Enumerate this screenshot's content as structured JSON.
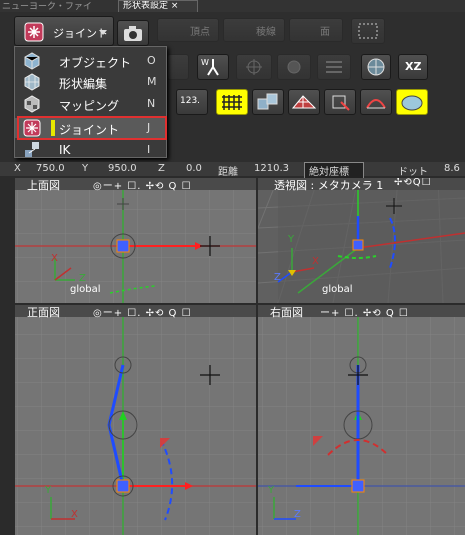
{
  "top_strip": {
    "left_text": "ニューヨーク・ファイ",
    "active_tab": "形状表設定 ×"
  },
  "mode_button": {
    "label": "ジョイント"
  },
  "view_tabs": [
    "頂点",
    "稜線",
    "面"
  ],
  "axis_button": "XZ",
  "numeric_button": "123.",
  "menu": {
    "items": [
      {
        "label": "オブジェクト",
        "key": "O",
        "icon": "cube-icon"
      },
      {
        "label": "形状編集",
        "key": "M",
        "icon": "mesh-cube-icon"
      },
      {
        "label": "マッピング",
        "key": "N",
        "icon": "checker-cube-icon"
      },
      {
        "label": "ジョイント",
        "key": "J",
        "icon": "joint-icon"
      },
      {
        "label": "IK",
        "key": "I",
        "icon": "ik-chain-icon"
      }
    ],
    "selected_index": 3
  },
  "coords": {
    "x_label": "X",
    "x_value": "750.0",
    "y_label": "Y",
    "y_value": "950.0",
    "z_label": "Z",
    "z_value": "0.0",
    "dist_label": "距離",
    "dist_value": "1210.3",
    "mode_select": "絶対座標",
    "dot_label": "ドット",
    "dot_value": "8.6"
  },
  "viewports": [
    {
      "title": "上面図",
      "tools": "◎ー+ ☐.    ✢⟲ Q ☐",
      "global_label": "global"
    },
    {
      "title": "透視図 : メタカメラ 1",
      "tools": "✢⟲Q☐",
      "global_label": "global"
    },
    {
      "title": "正面図",
      "tools": "◎ー+ ☐.    ✢⟲ Q ☐",
      "global_label": ""
    },
    {
      "title": "右面図",
      "tools": "ー+ ☐.    ✢⟲ Q ☐",
      "global_label": ""
    }
  ],
  "axis_labels": {
    "x": "X",
    "y": "Y",
    "z": "Z"
  },
  "colors": {
    "viewport_bg": "#757575",
    "grid": "#848484",
    "accent_yellow": "#ffff00",
    "selection_red": "#e03030",
    "bone_blue": "#1f4cff"
  }
}
